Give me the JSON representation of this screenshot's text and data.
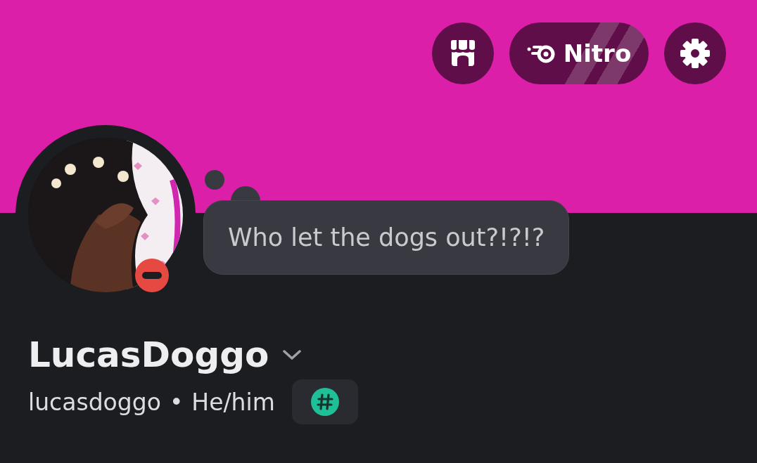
{
  "header_buttons": [
    {
      "kind": "shop"
    },
    {
      "kind": "nitro",
      "label": "Nitro"
    },
    {
      "kind": "settings"
    }
  ],
  "avatar": {
    "kind": "picture",
    "do_not_disturb": true
  },
  "custom_status": "Who let the dogs out?!?!?",
  "display_name": "LucasDoggo",
  "username": "lucasdoggo",
  "separator": "•",
  "pronouns": "He/him",
  "badges": [
    {
      "kind": "hashtag"
    }
  ]
}
